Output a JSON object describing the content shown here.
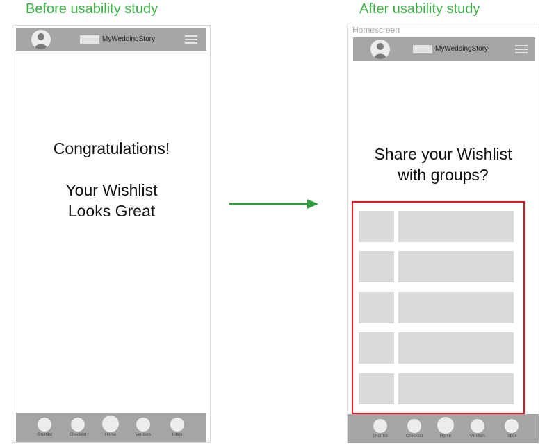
{
  "captions": {
    "before": "Before usability study",
    "after": "After usability study"
  },
  "app": {
    "name": "MyWeddingStory"
  },
  "screen_label": "Homescreen",
  "before_screen": {
    "line1": "Congratulations!",
    "line2": "Your Wishlist",
    "line3": "Looks Great"
  },
  "after_screen": {
    "line1": "Share your Wishlist",
    "line2": "with groups?",
    "list_rows": 5
  },
  "nav_items": [
    "Shortlist",
    "Checklist",
    "Home",
    "Vendors",
    "Inbox"
  ],
  "colors": {
    "caption": "#3cb045",
    "arrow": "#2e9e3e",
    "highlight": "#e8141f",
    "bar": "#a5a5a5",
    "placeholder": "#d9d9d9"
  },
  "icons": {
    "avatar": "user-avatar-icon",
    "menu": "hamburger-menu-icon",
    "arrow": "right-arrow-icon"
  }
}
